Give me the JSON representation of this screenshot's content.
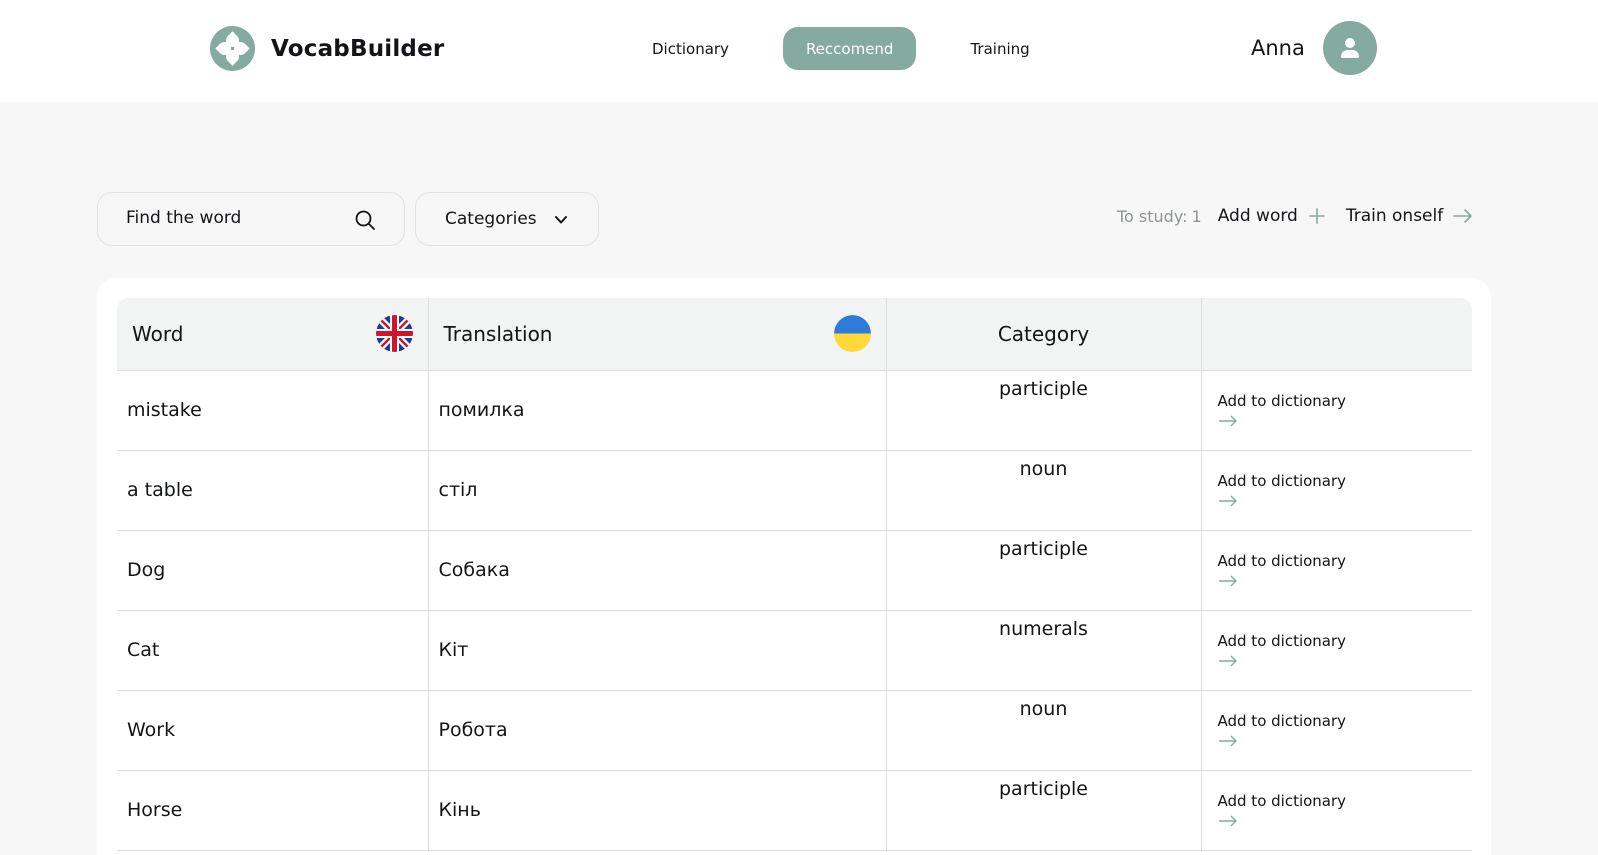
{
  "brand": {
    "name": "VocabBuilder"
  },
  "nav": {
    "items": [
      {
        "label": "Dictionary",
        "active": false
      },
      {
        "label": "Reccomend",
        "active": true
      },
      {
        "label": "Training",
        "active": false
      }
    ]
  },
  "user": {
    "name": "Anna"
  },
  "toolbar": {
    "search_placeholder": "Find the word",
    "categories_label": "Categories",
    "study_label": "To study:",
    "study_count": "1",
    "add_word_label": "Add word",
    "train_label": "Train onself"
  },
  "table": {
    "headers": {
      "word": "Word",
      "translation": "Translation",
      "category": "Category",
      "action": ""
    },
    "rows": [
      {
        "word": "mistake",
        "translation": "помилка",
        "category": "participle",
        "action": "Add to dictionary"
      },
      {
        "word": "a table",
        "translation": "стіл",
        "category": "noun",
        "action": "Add to dictionary"
      },
      {
        "word": "Dog",
        "translation": "Собака",
        "category": "participle",
        "action": "Add to dictionary"
      },
      {
        "word": "Cat",
        "translation": "Кіт",
        "category": "numerals",
        "action": "Add to dictionary"
      },
      {
        "word": "Work",
        "translation": "Робота",
        "category": "noun",
        "action": "Add to dictionary"
      },
      {
        "word": "Horse",
        "translation": "Кінь",
        "category": "participle",
        "action": "Add to dictionary"
      }
    ]
  },
  "colors": {
    "accent": "#85aa9f",
    "background": "#f7f7f7",
    "text": "#121417",
    "muted": "#8f9492"
  },
  "icons": [
    "logo-icon",
    "search-icon",
    "chevron-down-icon",
    "plus-icon",
    "arrow-right-icon",
    "uk-flag-icon",
    "ua-flag-icon",
    "user-avatar-icon"
  ]
}
